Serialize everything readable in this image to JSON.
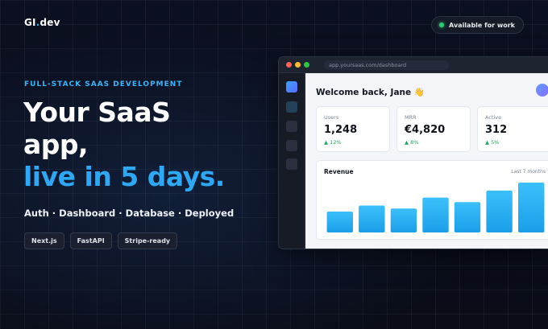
{
  "brand": {
    "logo_main": "GI",
    "logo_dot": ".",
    "logo_tld": "dev"
  },
  "status": {
    "label": "Available for work",
    "color": "#2ecc71"
  },
  "hero": {
    "kicker": "FULL-STACK SAAS DEVELOPMENT",
    "line1": "Your SaaS",
    "line2": "app,",
    "line3": "live in 5 days.",
    "features": "Auth · Dashboard · Database · Deployed",
    "chips": [
      "Next.js",
      "FastAPI",
      "Stripe-ready"
    ]
  },
  "mockup": {
    "url": "app.yoursaas.com/dashboard",
    "welcome": "Welcome back, Jane 👋",
    "stats": [
      {
        "label": "Users",
        "value": "1,248",
        "delta": "▲ 12%"
      },
      {
        "label": "MRR",
        "value": "€4,820",
        "delta": "▲ 8%"
      },
      {
        "label": "Active",
        "value": "312",
        "delta": "▲ 5%"
      }
    ],
    "revenue_title": "Revenue",
    "revenue_range": "Last 7 months"
  },
  "chart_data": {
    "type": "bar",
    "categories": [
      "",
      "",
      "",
      "",
      "",
      "",
      ""
    ],
    "values": [
      42,
      54,
      48,
      70,
      61,
      84,
      100
    ],
    "ylim": [
      0,
      100
    ],
    "title": "Revenue",
    "xlabel": "",
    "ylabel": "",
    "grid": false
  },
  "colors": {
    "accent": "#2ea8f5",
    "background": "#0a0e1a",
    "bar_top": "#3cc0fb",
    "bar_bottom": "#1a9ee8"
  }
}
